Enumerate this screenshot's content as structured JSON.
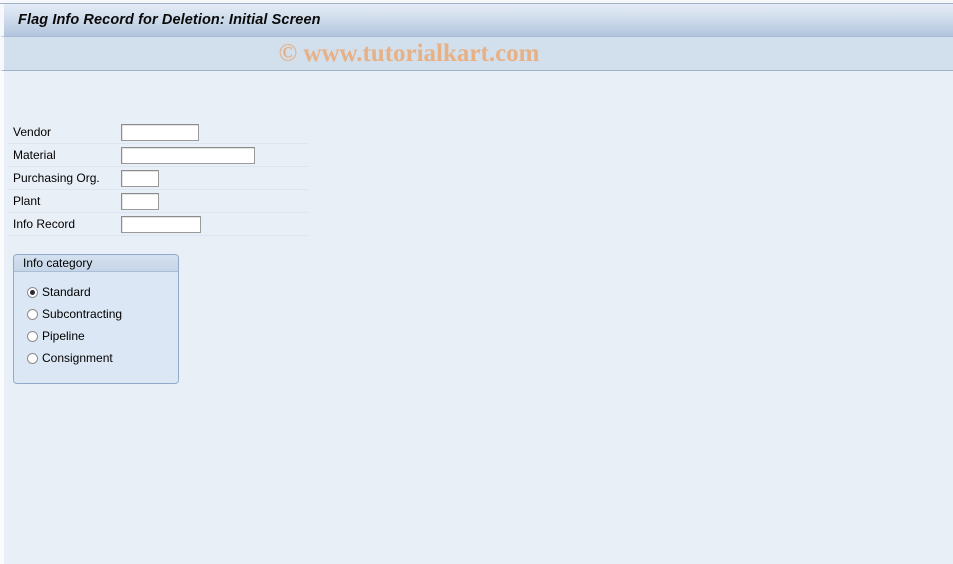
{
  "window": {
    "title": "Flag Info Record for Deletion: Initial Screen"
  },
  "watermark": {
    "text": "© www.tutorialkart.com",
    "color": "#e8b185"
  },
  "form": {
    "fields": [
      {
        "label": "Vendor",
        "value": "",
        "placeholder": ""
      },
      {
        "label": "Material",
        "value": "",
        "placeholder": ""
      },
      {
        "label": "Purchasing Org.",
        "value": "",
        "placeholder": ""
      },
      {
        "label": "Plant",
        "value": "",
        "placeholder": ""
      },
      {
        "label": "Info Record",
        "value": "",
        "placeholder": ""
      }
    ]
  },
  "info_category": {
    "title": "Info category",
    "selected": "Standard",
    "options": [
      {
        "label": "Standard",
        "selected": true
      },
      {
        "label": "Subcontracting",
        "selected": false
      },
      {
        "label": "Pipeline",
        "selected": false
      },
      {
        "label": "Consignment",
        "selected": false
      }
    ]
  },
  "theme": {
    "title_bar_color": "#bdcee3",
    "toolbar_color": "#d2dfec",
    "content_bg": "#e9eff7",
    "group_bg": "#dbe7f4",
    "group_border": "#8fabc9"
  }
}
